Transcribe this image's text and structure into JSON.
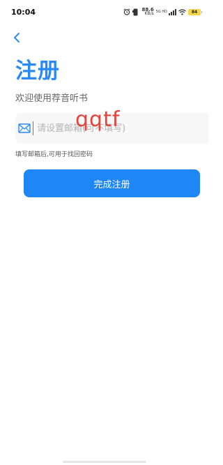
{
  "status_bar": {
    "time": "10:04",
    "net_speed_value": "88.6",
    "net_speed_unit": "KB/s",
    "network_label": "5G HD",
    "battery": "84"
  },
  "page": {
    "title": "注册",
    "subtitle": "欢迎使用荐音听书"
  },
  "email": {
    "placeholder": "请设置邮箱(可不填写)",
    "value": ""
  },
  "watermark": "qqtf",
  "hint": "填写邮箱后,可用于找回密码",
  "submit_label": "完成注册",
  "colors": {
    "accent": "#2a8af3",
    "button": "#1f87f5",
    "watermark": "#e4433b",
    "battery": "#f7d44a"
  },
  "icons": {
    "back": "chevron-left-icon",
    "mail": "mail-icon",
    "alarm": "alarm-icon",
    "nfc": "phone-icon",
    "signal": "signal-icon",
    "wifi": "wifi-icon",
    "battery": "battery-icon"
  }
}
